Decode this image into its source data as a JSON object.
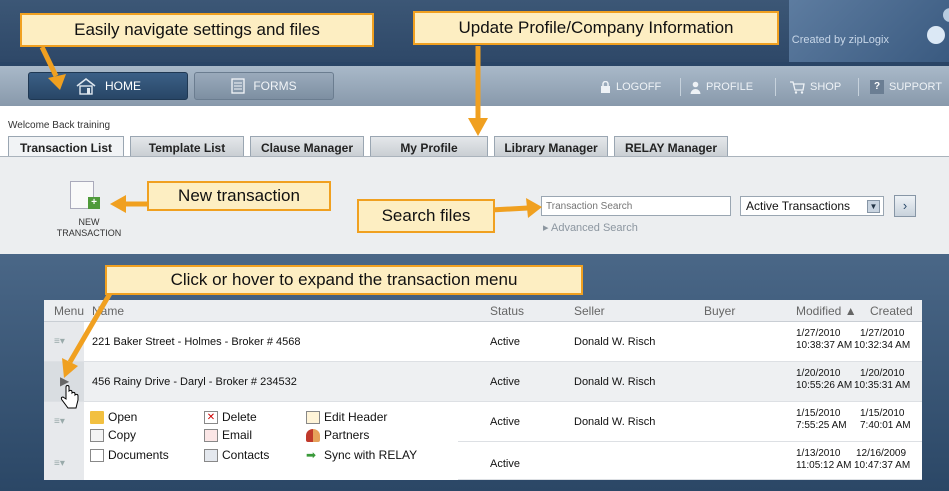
{
  "header": {
    "credit": "Created by zipLogix"
  },
  "nav": {
    "home": "HOME",
    "forms": "FORMS",
    "logoff": "LOGOFF",
    "profile": "PROFILE",
    "shop": "SHOP",
    "support": "SUPPORT"
  },
  "welcome": "Welcome Back training",
  "tabs": [
    "Transaction List",
    "Template List",
    "Clause Manager",
    "My Profile",
    "Library Manager",
    "RELAY Manager"
  ],
  "toolbar": {
    "new_transaction": "NEW TRANSACTION",
    "search_placeholder": "Transaction Search",
    "advanced_search": "Advanced Search",
    "filter_selected": "Active Transactions",
    "go": "›"
  },
  "table": {
    "headers": {
      "menu": "Menu",
      "name": "Name",
      "status": "Status",
      "seller": "Seller",
      "buyer": "Buyer",
      "modified": "Modified ▲",
      "created": "Created"
    },
    "rows": [
      {
        "name": "221 Baker Street - Holmes - Broker # 4568",
        "status": "Active",
        "seller": "Donald W. Risch",
        "buyer": "",
        "modified_date": "1/27/2010",
        "modified_time": "10:38:37 AM",
        "created_date": "1/27/2010",
        "created_time": "10:32:34 AM"
      },
      {
        "name": "456 Rainy Drive - Daryl - Broker # 234532",
        "status": "Active",
        "seller": "Donald W. Risch",
        "buyer": "",
        "modified_date": "1/20/2010",
        "modified_time": "10:55:26 AM",
        "created_date": "1/20/2010",
        "created_time": "10:35:31 AM"
      },
      {
        "name": "",
        "status": "Active",
        "seller": "Donald W. Risch",
        "buyer": "",
        "modified_date": "1/15/2010",
        "modified_time": "7:55:25 AM",
        "created_date": "1/15/2010",
        "created_time": "7:40:01 AM"
      },
      {
        "name": "",
        "status": "Active",
        "seller": "",
        "buyer": "",
        "modified_date": "1/13/2010",
        "modified_time": "11:05:12 AM",
        "created_date": "12/16/2009",
        "created_time": "10:47:37 AM"
      }
    ]
  },
  "context_menu": {
    "open": "Open",
    "copy": "Copy",
    "documents": "Documents",
    "delete": "Delete",
    "email": "Email",
    "contacts": "Contacts",
    "edit_header": "Edit Header",
    "partners": "Partners",
    "sync": "Sync with RELAY"
  },
  "callouts": {
    "navigate": "Easily navigate settings and files",
    "profile": "Update Profile/Company Information",
    "new_tx": "New transaction",
    "search": "Search files",
    "expand": "Click or hover to expand the transaction menu"
  },
  "colors": {
    "accent": "#f0a020",
    "callout_bg": "#fdeec2",
    "nav_dark": "#284666"
  }
}
